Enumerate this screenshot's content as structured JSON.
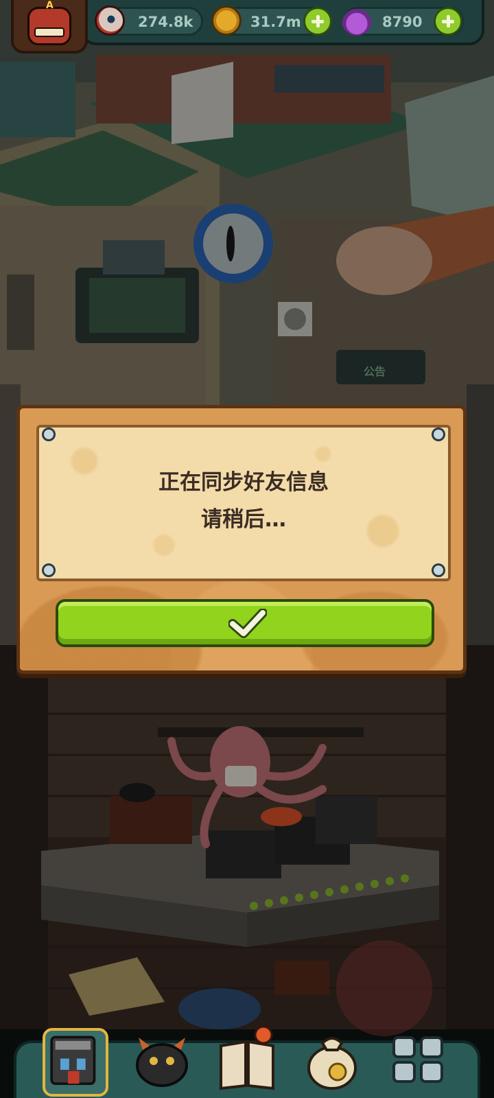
{
  "resources": {
    "eyeballs": {
      "value": "274.8k",
      "icon": "eyeball-icon"
    },
    "coins": {
      "value": "31.7m",
      "icon": "coin-icon"
    },
    "potions": {
      "value": "8790",
      "icon": "potion-icon"
    }
  },
  "avatar": {
    "badge_letter": "A"
  },
  "scene": {
    "sign_text": "公告"
  },
  "dialog": {
    "message_line1": "正在同步好友信息",
    "message_line2": "请稍后…",
    "confirm_icon": "checkmark-icon"
  },
  "bottom_nav": {
    "items": [
      {
        "name": "shop",
        "icon": "shop-icon",
        "active": true
      },
      {
        "name": "monster",
        "icon": "monster-icon",
        "active": false
      },
      {
        "name": "book",
        "icon": "book-icon",
        "active": false
      },
      {
        "name": "bag",
        "icon": "money-bag-icon",
        "active": false
      },
      {
        "name": "grid",
        "icon": "grid-icon",
        "active": false
      }
    ]
  },
  "colors": {
    "confirm_button": "#92d31d",
    "dialog_wood": "#d99a55",
    "parchment": "#f3dbaa",
    "message_text": "#3b2d24",
    "resource_text": "#a9c9c2"
  }
}
